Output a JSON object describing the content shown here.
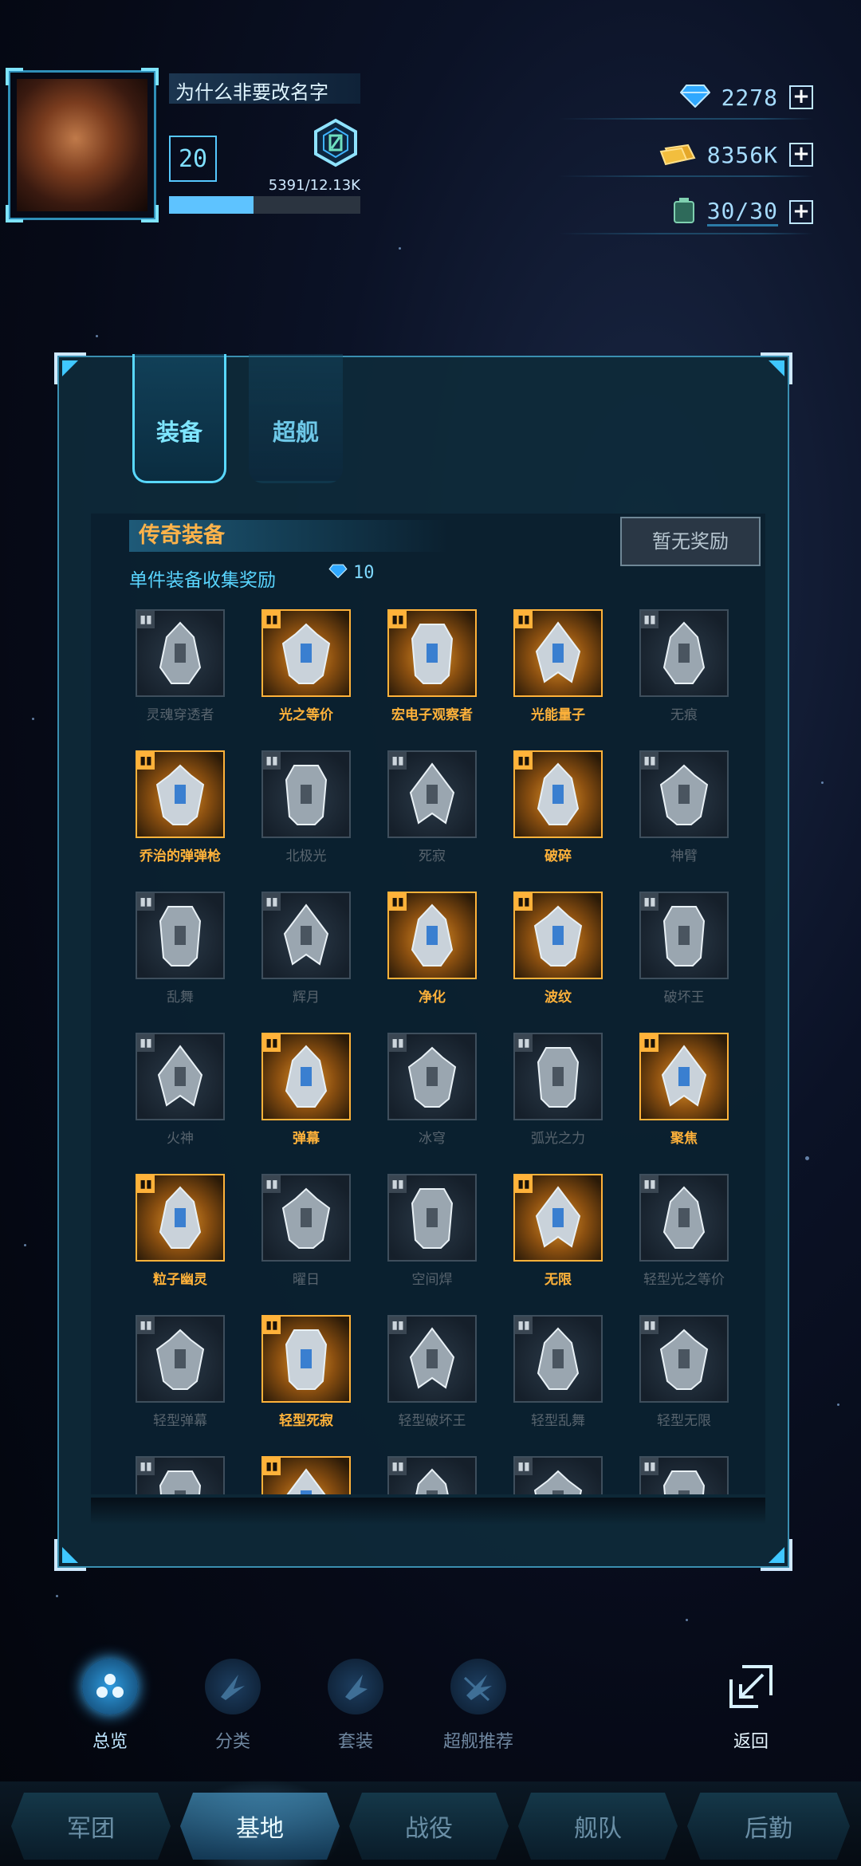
{
  "player": {
    "name": "为什么非要改名字",
    "level": "20",
    "rank_icon": "hexagon-rank-icon",
    "xp_text": "5391/12.13K",
    "xp_progress": 0.44
  },
  "resources": [
    {
      "icon": "diamond-icon",
      "value": "2278"
    },
    {
      "icon": "gold-bars-icon",
      "value": "8356K"
    },
    {
      "icon": "fuel-can-icon",
      "value": "30/30"
    }
  ],
  "tabs": [
    {
      "label": "装备",
      "active": true
    },
    {
      "label": "超舰",
      "active": false
    }
  ],
  "section": {
    "title": "传奇装备",
    "reward_button": "暂无奖励",
    "subtitle": "单件装备收集奖励",
    "reward_amount": "10"
  },
  "items": [
    {
      "name": "灵魂穿透者",
      "owned": false
    },
    {
      "name": "光之等价",
      "owned": true
    },
    {
      "name": "宏电子观察者",
      "owned": true
    },
    {
      "name": "光能量子",
      "owned": true
    },
    {
      "name": "无痕",
      "owned": false
    },
    {
      "name": "乔治的弹弹枪",
      "owned": true
    },
    {
      "name": "北极光",
      "owned": false
    },
    {
      "name": "死寂",
      "owned": false
    },
    {
      "name": "破碎",
      "owned": true
    },
    {
      "name": "神臂",
      "owned": false
    },
    {
      "name": "乱舞",
      "owned": false
    },
    {
      "name": "辉月",
      "owned": false
    },
    {
      "name": "净化",
      "owned": true
    },
    {
      "name": "波纹",
      "owned": true
    },
    {
      "name": "破坏王",
      "owned": false
    },
    {
      "name": "火神",
      "owned": false
    },
    {
      "name": "弹幕",
      "owned": true
    },
    {
      "name": "冰穹",
      "owned": false
    },
    {
      "name": "弧光之力",
      "owned": false
    },
    {
      "name": "聚焦",
      "owned": true
    },
    {
      "name": "粒子幽灵",
      "owned": true
    },
    {
      "name": "曜日",
      "owned": false
    },
    {
      "name": "空间焊",
      "owned": false
    },
    {
      "name": "无限",
      "owned": true
    },
    {
      "name": "轻型光之等价",
      "owned": false
    },
    {
      "name": "轻型弹幕",
      "owned": false
    },
    {
      "name": "轻型死寂",
      "owned": true
    },
    {
      "name": "轻型破坏王",
      "owned": false
    },
    {
      "name": "轻型乱舞",
      "owned": false
    },
    {
      "name": "轻型无限",
      "owned": false
    },
    {
      "name": "",
      "owned": false
    },
    {
      "name": "",
      "owned": true
    },
    {
      "name": "",
      "owned": false
    },
    {
      "name": "",
      "owned": false
    },
    {
      "name": "",
      "owned": false
    }
  ],
  "actions": [
    {
      "label": "总览",
      "icon": "overview-icon",
      "active": true
    },
    {
      "label": "分类",
      "icon": "category-icon",
      "active": false
    },
    {
      "label": "套装",
      "icon": "set-icon",
      "active": false
    },
    {
      "label": "超舰推荐",
      "icon": "super-ship-recommend-icon",
      "active": false
    },
    {
      "label": "返回",
      "icon": "back-icon",
      "active": true
    }
  ],
  "nav": [
    {
      "label": "军团",
      "active": false
    },
    {
      "label": "基地",
      "active": true
    },
    {
      "label": "战役",
      "active": false
    },
    {
      "label": "舰队",
      "active": false
    },
    {
      "label": "后勤",
      "active": false
    }
  ],
  "colors": {
    "accent": "#59d8ff",
    "legendary": "#ffb23a",
    "locked_text": "#58646e"
  }
}
